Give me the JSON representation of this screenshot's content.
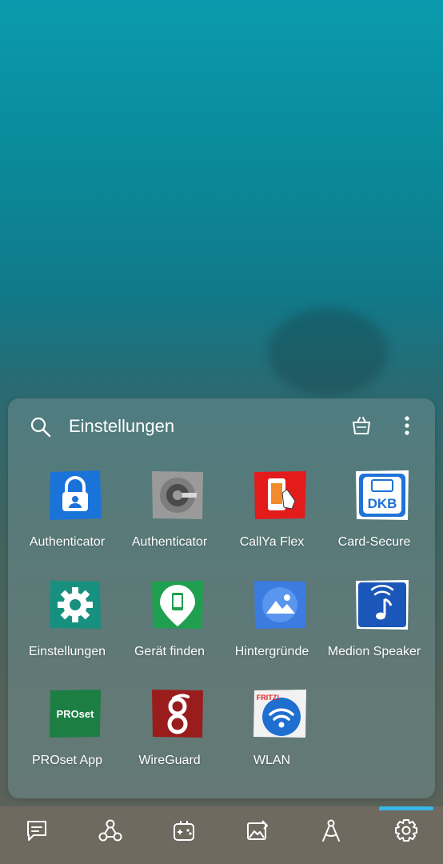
{
  "folder": {
    "title": "Einstellungen",
    "icons": {
      "search": "search-icon",
      "store": "shopping-bag-icon",
      "more": "more-vertical-icon"
    }
  },
  "apps": [
    {
      "label": "Authenticator",
      "icon": "microsoft-authenticator-icon",
      "color": "#1a73d8"
    },
    {
      "label": "Authenticator",
      "icon": "google-authenticator-icon",
      "color": "#9a9a9a"
    },
    {
      "label": "CallYa Flex",
      "icon": "callya-flex-icon",
      "color": "#e31b1b"
    },
    {
      "label": "Card-Secure",
      "icon": "dkb-card-secure-icon",
      "color": "#1e73d6",
      "icon_text": "DKB"
    },
    {
      "label": "Einstellungen",
      "icon": "settings-gear-icon",
      "color": "#17907f"
    },
    {
      "label": "Gerät finden",
      "icon": "find-device-icon",
      "color": "#1f9f4f"
    },
    {
      "label": "Hintergründe",
      "icon": "wallpapers-icon",
      "color": "#3c7be0"
    },
    {
      "label": "Medion Speaker",
      "icon": "medion-speaker-icon",
      "color": "#1b57b8"
    },
    {
      "label": "PROset App",
      "icon": "proset-app-icon",
      "color": "#1c7e43",
      "icon_text": "PROset"
    },
    {
      "label": "WireGuard",
      "icon": "wireguard-icon",
      "color": "#9a1d1d"
    },
    {
      "label": "WLAN",
      "icon": "fritz-wlan-icon",
      "color": "#1e6fd0",
      "icon_text": "FRITZ!"
    }
  ],
  "dock": [
    {
      "icon": "messages-icon"
    },
    {
      "icon": "share-nodes-icon"
    },
    {
      "icon": "game-controller-icon"
    },
    {
      "icon": "gallery-edit-icon"
    },
    {
      "icon": "compass-tool-icon"
    },
    {
      "icon": "settings-icon",
      "active": true
    }
  ],
  "colors": {
    "dock_indicator": "#38b6e8",
    "dock_background": "#6f6a60"
  }
}
